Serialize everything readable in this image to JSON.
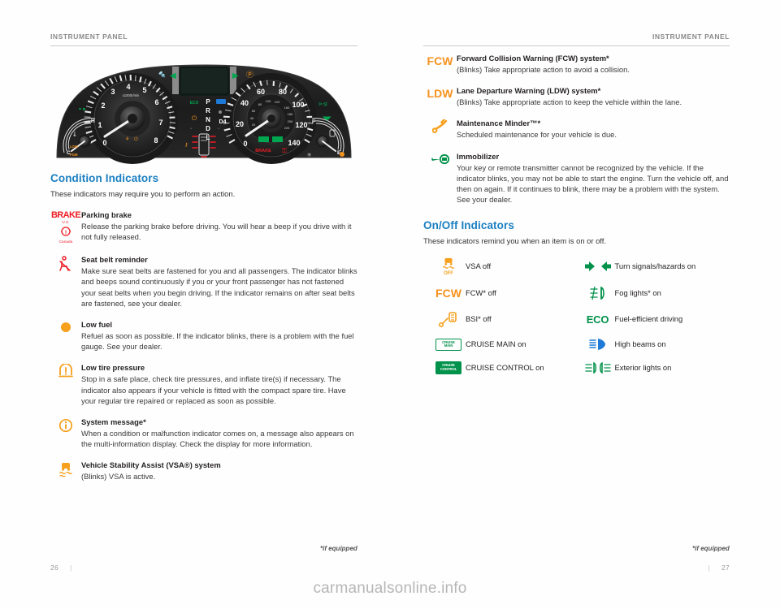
{
  "colors": {
    "heading_blue": "#1a7fc1",
    "amber": "#f6921e",
    "red": "#ed1c24",
    "green": "#00914a",
    "rule": "#c9c9c9",
    "runhead": "#8a8a8a"
  },
  "left_page": {
    "running_head": "INSTRUMENT PANEL",
    "figure_alt": "Instrument cluster illustration",
    "cluster": {
      "tach_label": "x1000r/min",
      "tach_ticks": [
        "0",
        "1",
        "2",
        "3",
        "4",
        "5",
        "6",
        "7",
        "8"
      ],
      "speedo_unit": "mph",
      "speedo_inner_unit": "km/h",
      "speedo_ticks": [
        "0",
        "20",
        "40",
        "60",
        "80",
        "100",
        "120",
        "140"
      ],
      "speedo_inner_ticks": [
        "20",
        "40",
        "60",
        "80",
        "100",
        "120",
        "160",
        "180",
        "200",
        "220"
      ],
      "gear_positions": [
        "P",
        "R",
        "N",
        "D",
        "L"
      ],
      "gear_extra": "D4",
      "eco_text": "ECO",
      "brake_text": "BRAKE",
      "temp_gauge": {
        "hot": "H",
        "cold": "C"
      },
      "fuel_gauge": {
        "full": "F",
        "empty": "E"
      }
    },
    "section": {
      "title": "Condition Indicators",
      "intro": "These indicators may require you to perform an action."
    },
    "entries": [
      {
        "icon": "parking-brake-icon",
        "icon_kind": "brake-text",
        "brake_word": "BRAKE",
        "brake_us": "U.S.",
        "brake_canada": "Canada",
        "title": "Parking brake",
        "desc": "Release the parking brake before driving. You will hear a beep if you drive with it not fully released."
      },
      {
        "icon": "seat-belt-reminder-icon",
        "icon_kind": "seatbelt",
        "title": "Seat belt reminder",
        "desc": "Make sure seat belts are fastened for you and all passengers. The indicator blinks and beeps sound continuously if you or your front passenger has not fastened your seat belts when you begin driving. If the indicator remains on after seat belts are fastened, see your dealer."
      },
      {
        "icon": "low-fuel-icon",
        "icon_kind": "fuel-dot",
        "title": "Low fuel",
        "desc": "Refuel as soon as possible. If the indicator blinks, there is a problem with the fuel gauge. See your dealer."
      },
      {
        "icon": "low-tire-pressure-icon",
        "icon_kind": "tpms",
        "title": "Low tire pressure",
        "desc": "Stop in a safe place, check tire pressures, and inflate tire(s) if necessary. The indicator also appears if your vehicle is fitted with the compact spare tire. Have your regular tire repaired or replaced as soon as possible."
      },
      {
        "icon": "system-message-icon",
        "icon_kind": "info",
        "title": "System message*",
        "desc": "When a condition or malfunction indicator comes on, a message also appears on the multi-information display. Check the display for more information."
      },
      {
        "icon": "vsa-icon",
        "icon_kind": "vsa",
        "title_pre": "Vehicle Stability Assist (VSA",
        "title_reg": "®",
        "title_post": ") system",
        "title": "Vehicle Stability Assist (VSA®) system",
        "desc": "(Blinks) VSA is active."
      }
    ],
    "footnote": "*if equipped",
    "folio": "26"
  },
  "right_page": {
    "running_head": "INSTRUMENT PANEL",
    "entries": [
      {
        "icon": "fcw-icon",
        "icon_kind": "text-amber",
        "icon_text": "FCW",
        "title": "Forward Collision Warning (FCW) system*",
        "desc": "(Blinks) Take appropriate action to avoid a collision."
      },
      {
        "icon": "ldw-icon",
        "icon_kind": "text-amber",
        "icon_text": "LDW",
        "title": "Lane Departure Warning (LDW) system*",
        "desc": "(Blinks) Take appropriate action to keep the vehicle within the lane."
      },
      {
        "icon": "maintenance-minder-wrench-icon",
        "icon_kind": "wrench",
        "title_pre": "Maintenance Minder",
        "title_tm": "™",
        "title_post": "*",
        "title": "Maintenance Minder™*",
        "desc": "Scheduled maintenance for your vehicle is due."
      },
      {
        "icon": "immobilizer-key-icon",
        "icon_kind": "key",
        "title": "Immobilizer",
        "desc": "Your key or remote transmitter cannot be recognized by the vehicle. If the indicator blinks, you may not be able to start the engine. Turn the vehicle off, and then on again. If it continues to blink, there may be a problem with the system. See your dealer."
      }
    ],
    "section": {
      "title": "On/Off Indicators",
      "intro": "These indicators remind you when an item is on or off."
    },
    "onoff": [
      {
        "icon": "vsa-off-icon",
        "icon_kind": "vsa-off",
        "label": "VSA off"
      },
      {
        "icon": "turn-signal-arrows-icon",
        "icon_kind": "turn-arrows",
        "label": "Turn signals/hazards on"
      },
      {
        "icon": "fcw-off-icon",
        "icon_kind": "text-amber",
        "icon_text": "FCW",
        "label": "FCW* off"
      },
      {
        "icon": "fog-lights-icon",
        "icon_kind": "fog",
        "label": "Fog lights* on"
      },
      {
        "icon": "bsi-off-icon",
        "icon_kind": "bsi",
        "label": "BSI* off"
      },
      {
        "icon": "eco-icon",
        "icon_kind": "text-green",
        "icon_text": "ECO",
        "label": "Fuel-efficient driving"
      },
      {
        "icon": "cruise-main-icon",
        "icon_kind": "chip-outline",
        "chip_line1": "CRUISE",
        "chip_line2": "MAIN",
        "label": "CRUISE MAIN on"
      },
      {
        "icon": "high-beams-icon",
        "icon_kind": "highbeam",
        "label": "High beams on"
      },
      {
        "icon": "cruise-control-icon",
        "icon_kind": "chip-filled",
        "chip_line1": "CRUISE",
        "chip_line2": "CONTROL",
        "label": "CRUISE CONTROL on"
      },
      {
        "icon": "exterior-lights-icon",
        "icon_kind": "exterior",
        "label": "Exterior lights on"
      }
    ],
    "footnote": "*if equipped",
    "folio": "27"
  },
  "watermark": "carmanualsonline.info"
}
